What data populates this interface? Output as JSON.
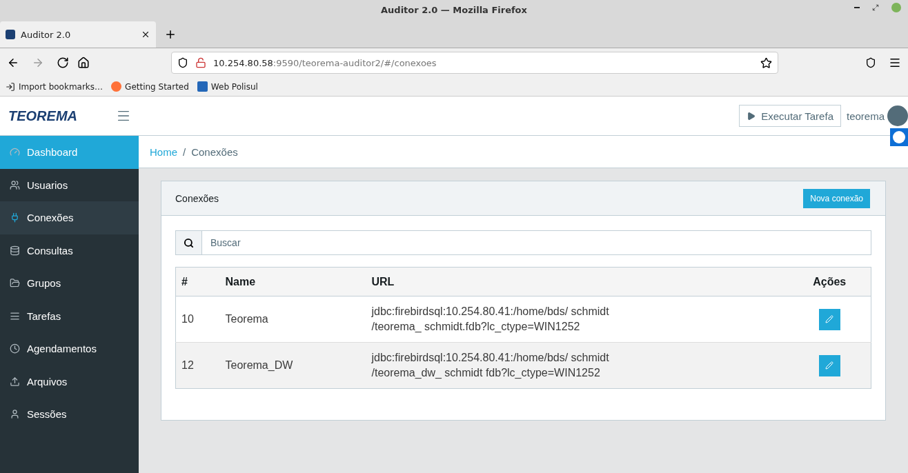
{
  "window": {
    "title": "Auditor 2.0 — Mozilla Firefox"
  },
  "browser_tabs": [
    {
      "label": "Auditor 2.0",
      "selected": true
    }
  ],
  "address_bar": {
    "host": "10.254.80.58",
    "path": ":9590/teorema-auditor2/#/conexoes"
  },
  "bookmarks": [
    {
      "label": "Import bookmarks…",
      "kind": "import"
    },
    {
      "label": "Getting Started",
      "kind": "firefox"
    },
    {
      "label": "Web Polisul",
      "kind": "site"
    }
  ],
  "header": {
    "logo": "TEOREMA",
    "run_button": "Executar Tarefa",
    "user": "teorema"
  },
  "sidebar": {
    "items": [
      {
        "label": "Dashboard",
        "selected": true,
        "hovered": false
      },
      {
        "label": "Usuarios",
        "selected": false,
        "hovered": false
      },
      {
        "label": "Conexões",
        "selected": false,
        "hovered": true
      },
      {
        "label": "Consultas",
        "selected": false,
        "hovered": false
      },
      {
        "label": "Grupos",
        "selected": false,
        "hovered": false
      },
      {
        "label": "Tarefas",
        "selected": false,
        "hovered": false
      },
      {
        "label": "Agendamentos",
        "selected": false,
        "hovered": false
      },
      {
        "label": "Arquivos",
        "selected": false,
        "hovered": false
      },
      {
        "label": "Sessões",
        "selected": false,
        "hovered": false
      }
    ]
  },
  "breadcrumb": {
    "separator": "/",
    "items": [
      {
        "label": "Home",
        "link": true
      },
      {
        "label": "Conexões",
        "link": false
      }
    ]
  },
  "card": {
    "title": "Conexões",
    "new_button": "Nova conexão",
    "search": {
      "placeholder": "Buscar"
    },
    "table": {
      "columns": [
        "#",
        "Name",
        "URL",
        "Ações"
      ],
      "rows": [
        {
          "id": "10",
          "name": "Teorema",
          "url": [
            "jdbc:firebirdsql:10.254.80.41:/home/bds/ schmidt",
            "/teorema_ schmidt.fdb?lc_ctype=WIN1252"
          ]
        },
        {
          "id": "12",
          "name": "Teorema_DW",
          "url": [
            "jdbc:firebirdsql:10.254.80.41:/home/bds/ schmidt",
            "/teorema_dw_ schmidt fdb?lc_ctype=WIN1252"
          ]
        }
      ]
    }
  }
}
